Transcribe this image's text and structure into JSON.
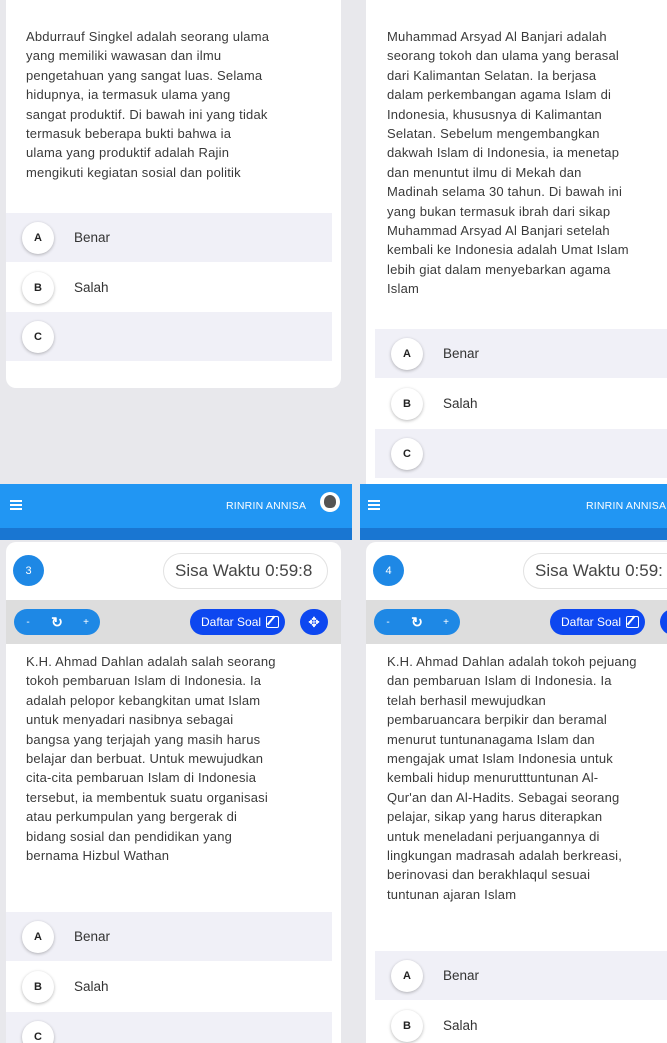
{
  "app": {
    "user_name": "RINRIN ANNISA",
    "timer_label": "Sisa Waktu",
    "daftar_soal": "Daftar Soal",
    "colors": {
      "primary_bar": "#2196f3",
      "number_badge": "#1e88e5",
      "daftar_button": "#0d47f0",
      "option_shade": "#f0f0f7"
    },
    "icons": {
      "menu": "menu-icon",
      "refresh": "refresh-icon",
      "edit": "edit-icon",
      "move": "move-icon",
      "avatar": "avatar"
    }
  },
  "top_left": {
    "question": "Abdurrauf Singkel adalah seorang ulama\nyang memiliki wawasan dan ilmu\npengetahuan yang sangat luas. Selama\nhidupnya, ia termasuk ulama yang\nsangat produktif. Di bawah ini yang tidak\ntermasuk beberapa bukti bahwa ia\nulama yang produktif adalah Rajin\nmengikuti kegiatan sosial dan politik",
    "options": [
      {
        "letter": "A",
        "label": "Benar"
      },
      {
        "letter": "B",
        "label": "Salah"
      },
      {
        "letter": "C",
        "label": ""
      }
    ]
  },
  "top_right": {
    "question": "Muhammad Arsyad Al Banjari adalah\nseorang tokoh dan ulama yang berasal\ndari Kalimantan Selatan. Ia berjasa\ndalam perkembangan agama Islam di\nIndonesia, khususnya di Kalimantan\nSelatan. Sebelum mengembangkan\ndakwah Islam di Indonesia, ia menetap\ndan menuntut ilmu di Mekah dan\nMadinah selama 30 tahun. Di bawah ini\nyang bukan termasuk ibrah dari sikap\nMuhammad Arsyad Al Banjari setelah\nkembali ke Indonesia adalah Umat Islam\nlebih giat dalam menyebarkan agama\nIslam",
    "options": [
      {
        "letter": "A",
        "label": "Benar"
      },
      {
        "letter": "B",
        "label": "Salah"
      },
      {
        "letter": "C",
        "label": ""
      }
    ]
  },
  "bottom_left": {
    "number": "3",
    "time": "0:59:8",
    "zoom_minus": "-",
    "zoom_plus": "+",
    "question": "K.H. Ahmad Dahlan adalah salah seorang\ntokoh pembaruan Islam di Indonesia. Ia\nadalah pelopor kebangkitan umat Islam\nuntuk menyadari nasibnya sebagai\nbangsa yang terjajah yang masih harus\nbelajar dan berbuat. Untuk mewujudkan\ncita-cita pembaruan Islam di Indonesia\ntersebut, ia membentuk suatu organisasi\natau perkumpulan yang bergerak di\nbidang sosial dan pendidikan yang\nbernama Hizbul Wathan",
    "options": [
      {
        "letter": "A",
        "label": "Benar"
      },
      {
        "letter": "B",
        "label": "Salah"
      },
      {
        "letter": "C",
        "label": ""
      }
    ]
  },
  "bottom_right": {
    "number": "4",
    "time": "0:59:",
    "zoom_minus": "-",
    "zoom_plus": "+",
    "question": "K.H. Ahmad Dahlan adalah tokoh pejuang\ndan pembaruan Islam di Indonesia. Ia\ntelah berhasil mewujudkan\npembaruancara berpikir dan beramal\nmenurut tuntunanagama Islam dan\nmengajak umat Islam Indonesia untuk\nkembali hidup menurutttuntunan Al-\nQur'an dan Al-Hadits. Sebagai seorang\npelajar, sikap yang harus diterapkan\nuntuk meneladani perjuangannya di\nlingkungan madrasah adalah berkreasi,\nberinovasi dan berakhlaqul sesuai\ntuntunan ajaran Islam",
    "options": [
      {
        "letter": "A",
        "label": "Benar"
      },
      {
        "letter": "B",
        "label": "Salah"
      }
    ]
  }
}
